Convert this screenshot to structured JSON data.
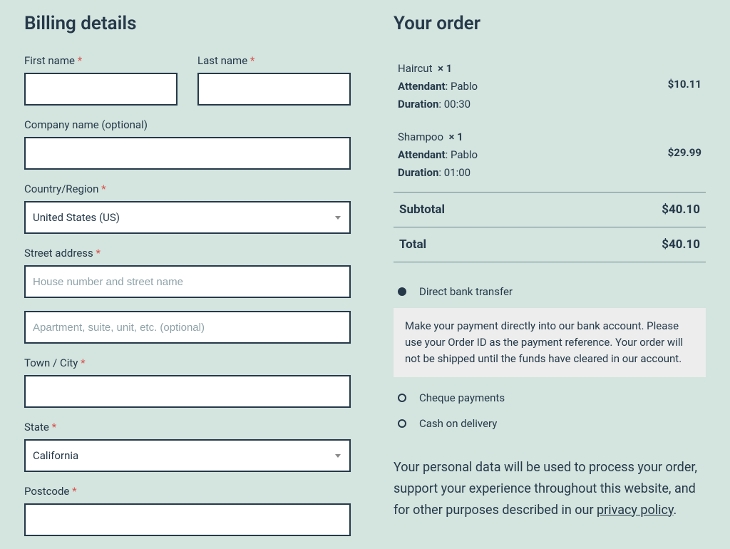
{
  "billing": {
    "heading": "Billing details",
    "first_name_label": "First name",
    "last_name_label": "Last name",
    "company_label": "Company name (optional)",
    "country_label": "Country/Region",
    "country_value": "United States (US)",
    "street_label": "Street address",
    "street1_placeholder": "House number and street name",
    "street2_placeholder": "Apartment, suite, unit, etc. (optional)",
    "city_label": "Town / City",
    "state_label": "State",
    "state_value": "California",
    "postcode_label": "Postcode",
    "required": "*"
  },
  "order": {
    "heading": "Your order",
    "items": [
      {
        "name": "Haircut",
        "qty": "× 1",
        "attendant_lbl": "Attendant",
        "attendant": "Pablo",
        "duration_lbl": "Duration",
        "duration": "00:30",
        "price": "$10.11"
      },
      {
        "name": "Shampoo",
        "qty": "× 1",
        "attendant_lbl": "Attendant",
        "attendant": "Pablo",
        "duration_lbl": "Duration",
        "duration": "01:00",
        "price": "$29.99"
      }
    ],
    "subtotal_label": "Subtotal",
    "subtotal": "$40.10",
    "total_label": "Total",
    "total": "$40.10"
  },
  "payment": {
    "options": [
      {
        "label": "Direct bank transfer",
        "selected": true,
        "desc": "Make your payment directly into our bank account. Please use your Order ID as the payment reference. Your order will not be shipped until the funds have cleared in our account."
      },
      {
        "label": "Cheque payments",
        "selected": false
      },
      {
        "label": "Cash on delivery",
        "selected": false
      }
    ]
  },
  "privacy": {
    "text_before": "Your personal data will be used to process your order, support your experience throughout this website, and for other purposes described in our ",
    "link": "privacy policy",
    "text_after": "."
  }
}
